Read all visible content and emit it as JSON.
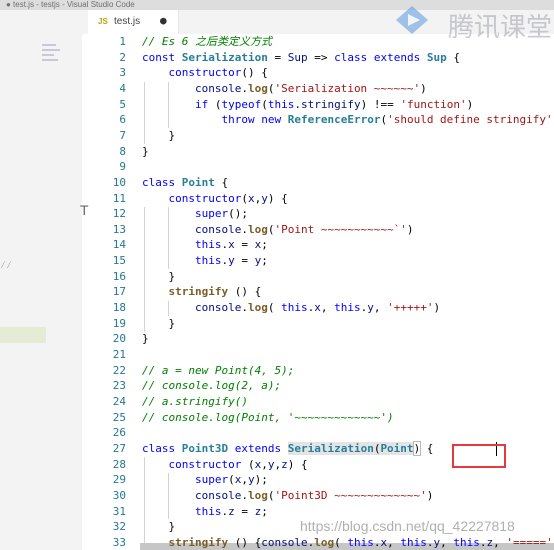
{
  "window": {
    "title": "● test.js - testjs - Visual Studio Code"
  },
  "tab": {
    "icon": "JS",
    "label": "test.js",
    "dirty_indicator": "●"
  },
  "watermarks": {
    "logo_text": "腾讯课堂",
    "csdn": "https://blog.csdn.net/qq_42227818"
  },
  "editor": {
    "lines": [
      {
        "n": "1",
        "tokens": [
          [
            "cmt",
            "// Es 6 之后类定义方式"
          ]
        ]
      },
      {
        "n": "2",
        "tokens": [
          [
            "kw",
            "const "
          ],
          [
            "cls",
            "Serialization"
          ],
          [
            "plain",
            " = "
          ],
          [
            "var",
            "Sup"
          ],
          [
            "plain",
            " => "
          ],
          [
            "kw",
            "class "
          ],
          [
            "kw",
            "extends "
          ],
          [
            "cls",
            "Sup"
          ],
          [
            "plain",
            " {"
          ]
        ]
      },
      {
        "n": "3",
        "tokens": [
          [
            "plain",
            "    "
          ],
          [
            "kw",
            "constructor"
          ],
          [
            "plain",
            "() {"
          ]
        ]
      },
      {
        "n": "4",
        "tokens": [
          [
            "plain",
            "        "
          ],
          [
            "var",
            "console"
          ],
          [
            "plain",
            "."
          ],
          [
            "fn",
            "log"
          ],
          [
            "plain",
            "("
          ],
          [
            "str",
            "'Serialization ~~~~~~'"
          ],
          [
            "plain",
            ")"
          ]
        ]
      },
      {
        "n": "5",
        "tokens": [
          [
            "plain",
            "        "
          ],
          [
            "kw",
            "if "
          ],
          [
            "plain",
            "("
          ],
          [
            "kw",
            "typeof"
          ],
          [
            "plain",
            "("
          ],
          [
            "kw",
            "this"
          ],
          [
            "plain",
            "."
          ],
          [
            "var",
            "stringify"
          ],
          [
            "plain",
            ") !== "
          ],
          [
            "str",
            "'function'"
          ],
          [
            "plain",
            ")"
          ]
        ]
      },
      {
        "n": "6",
        "tokens": [
          [
            "plain",
            "            "
          ],
          [
            "kw",
            "throw "
          ],
          [
            "kw",
            "new "
          ],
          [
            "cls",
            "ReferenceError"
          ],
          [
            "plain",
            "("
          ],
          [
            "str",
            "'should define stringify'"
          ],
          [
            "plain",
            ")"
          ]
        ]
      },
      {
        "n": "7",
        "tokens": [
          [
            "plain",
            "    }"
          ]
        ]
      },
      {
        "n": "8",
        "tokens": [
          [
            "plain",
            "}"
          ]
        ]
      },
      {
        "n": "9",
        "tokens": [
          [
            "plain",
            ""
          ]
        ]
      },
      {
        "n": "10",
        "tokens": [
          [
            "kw",
            "class "
          ],
          [
            "cls",
            "Point"
          ],
          [
            "plain",
            " {"
          ]
        ]
      },
      {
        "n": "11",
        "tokens": [
          [
            "plain",
            "    "
          ],
          [
            "kw",
            "constructor"
          ],
          [
            "plain",
            "("
          ],
          [
            "var",
            "x"
          ],
          [
            "plain",
            ","
          ],
          [
            "var",
            "y"
          ],
          [
            "plain",
            ") {"
          ]
        ]
      },
      {
        "n": "12",
        "tokens": [
          [
            "plain",
            "        "
          ],
          [
            "kw",
            "super"
          ],
          [
            "plain",
            "();"
          ]
        ]
      },
      {
        "n": "13",
        "tokens": [
          [
            "plain",
            "        "
          ],
          [
            "var",
            "console"
          ],
          [
            "plain",
            "."
          ],
          [
            "fn",
            "log"
          ],
          [
            "plain",
            "("
          ],
          [
            "str",
            "'Point ~~~~~~~~~~~`'"
          ],
          [
            "plain",
            ")"
          ]
        ]
      },
      {
        "n": "14",
        "tokens": [
          [
            "plain",
            "        "
          ],
          [
            "kw",
            "this"
          ],
          [
            "plain",
            "."
          ],
          [
            "var",
            "x"
          ],
          [
            "plain",
            " = "
          ],
          [
            "var",
            "x"
          ],
          [
            "plain",
            ";"
          ]
        ]
      },
      {
        "n": "15",
        "tokens": [
          [
            "plain",
            "        "
          ],
          [
            "kw",
            "this"
          ],
          [
            "plain",
            "."
          ],
          [
            "var",
            "y"
          ],
          [
            "plain",
            " = "
          ],
          [
            "var",
            "y"
          ],
          [
            "plain",
            ";"
          ]
        ]
      },
      {
        "n": "16",
        "tokens": [
          [
            "plain",
            "    }"
          ]
        ]
      },
      {
        "n": "17",
        "tokens": [
          [
            "plain",
            "    "
          ],
          [
            "fn",
            "stringify"
          ],
          [
            "plain",
            " () {"
          ]
        ]
      },
      {
        "n": "18",
        "tokens": [
          [
            "plain",
            "        "
          ],
          [
            "var",
            "console"
          ],
          [
            "plain",
            "."
          ],
          [
            "fn",
            "log"
          ],
          [
            "plain",
            "( "
          ],
          [
            "kw",
            "this"
          ],
          [
            "plain",
            "."
          ],
          [
            "var",
            "x"
          ],
          [
            "plain",
            ", "
          ],
          [
            "kw",
            "this"
          ],
          [
            "plain",
            "."
          ],
          [
            "var",
            "y"
          ],
          [
            "plain",
            ", "
          ],
          [
            "str",
            "'+++++'"
          ],
          [
            "plain",
            ")"
          ]
        ]
      },
      {
        "n": "19",
        "tokens": [
          [
            "plain",
            "    }"
          ]
        ]
      },
      {
        "n": "20",
        "tokens": [
          [
            "plain",
            "}"
          ]
        ]
      },
      {
        "n": "21",
        "tokens": [
          [
            "plain",
            ""
          ]
        ]
      },
      {
        "n": "22",
        "tokens": [
          [
            "cmt",
            "// a = new Point(4, 5);"
          ]
        ]
      },
      {
        "n": "23",
        "tokens": [
          [
            "cmt",
            "// console.log(2, a);"
          ]
        ]
      },
      {
        "n": "24",
        "tokens": [
          [
            "cmt",
            "// a.stringify()"
          ]
        ]
      },
      {
        "n": "25",
        "tokens": [
          [
            "cmt",
            "// console.log(Point, '~~~~~~~~~~~~~')"
          ]
        ]
      },
      {
        "n": "26",
        "tokens": [
          [
            "plain",
            ""
          ]
        ]
      },
      {
        "n": "27",
        "tokens": [
          [
            "kw",
            "class "
          ],
          [
            "cls",
            "Point3D"
          ],
          [
            "plain",
            " "
          ],
          [
            "kw",
            "extends "
          ],
          [
            "cls",
            "Serialization",
            "hl"
          ],
          [
            "plain",
            "(",
            "hl"
          ],
          [
            "cls",
            "Point",
            "hl"
          ],
          [
            "plain",
            ")",
            "bracket-hl"
          ],
          [
            "plain",
            " {"
          ]
        ]
      },
      {
        "n": "28",
        "tokens": [
          [
            "plain",
            "    "
          ],
          [
            "kw",
            "constructor"
          ],
          [
            "plain",
            " ("
          ],
          [
            "var",
            "x"
          ],
          [
            "plain",
            ","
          ],
          [
            "var",
            "y"
          ],
          [
            "plain",
            ","
          ],
          [
            "var",
            "z"
          ],
          [
            "plain",
            ") {"
          ]
        ]
      },
      {
        "n": "29",
        "tokens": [
          [
            "plain",
            "        "
          ],
          [
            "kw",
            "super"
          ],
          [
            "plain",
            "("
          ],
          [
            "var",
            "x"
          ],
          [
            "plain",
            ","
          ],
          [
            "var",
            "y"
          ],
          [
            "plain",
            ");"
          ]
        ]
      },
      {
        "n": "30",
        "tokens": [
          [
            "plain",
            "        "
          ],
          [
            "var",
            "console"
          ],
          [
            "plain",
            "."
          ],
          [
            "fn",
            "log"
          ],
          [
            "plain",
            "("
          ],
          [
            "str",
            "'Point3D ~~~~~~~~~~~~~'"
          ],
          [
            "plain",
            ")"
          ]
        ]
      },
      {
        "n": "31",
        "tokens": [
          [
            "plain",
            "        "
          ],
          [
            "kw",
            "this"
          ],
          [
            "plain",
            "."
          ],
          [
            "var",
            "z"
          ],
          [
            "plain",
            " = "
          ],
          [
            "var",
            "z"
          ],
          [
            "plain",
            ";"
          ]
        ]
      },
      {
        "n": "32",
        "tokens": [
          [
            "plain",
            "    }"
          ]
        ]
      },
      {
        "n": "33",
        "tokens": [
          [
            "plain",
            "    "
          ],
          [
            "fn",
            "stringify"
          ],
          [
            "plain",
            " () {"
          ],
          [
            "var",
            "console"
          ],
          [
            "plain",
            "."
          ],
          [
            "fn",
            "log"
          ],
          [
            "plain",
            "( "
          ],
          [
            "kw",
            "this"
          ],
          [
            "plain",
            "."
          ],
          [
            "var",
            "x"
          ],
          [
            "plain",
            ", "
          ],
          [
            "kw",
            "this"
          ],
          [
            "plain",
            "."
          ],
          [
            "var",
            "y"
          ],
          [
            "plain",
            ", "
          ],
          [
            "kw",
            "this"
          ],
          [
            "plain",
            "."
          ],
          [
            "var",
            "z"
          ],
          [
            "plain",
            ", "
          ],
          [
            "str",
            "'=====')"
          ]
        ]
      }
    ]
  }
}
